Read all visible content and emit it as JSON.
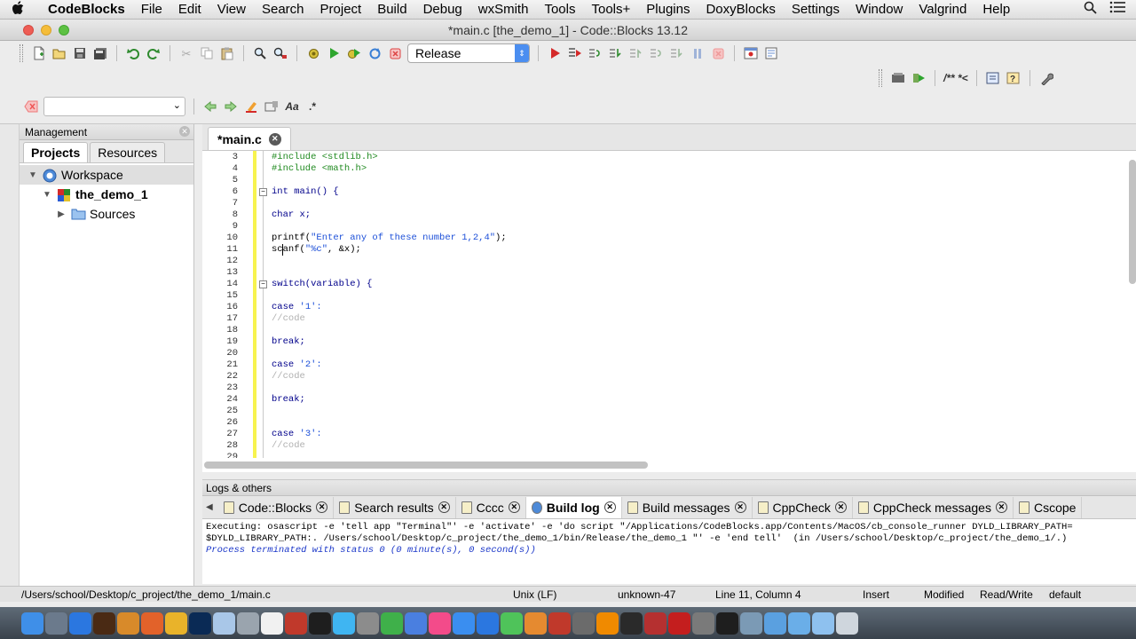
{
  "menubar": {
    "apple": "",
    "app_name": "CodeBlocks",
    "items": [
      "File",
      "Edit",
      "View",
      "Search",
      "Project",
      "Build",
      "Debug",
      "wxSmith",
      "Tools",
      "Tools+",
      "Plugins",
      "DoxyBlocks",
      "Settings",
      "Window",
      "Valgrind",
      "Help"
    ],
    "right_icons": [
      "search-icon",
      "list-icon"
    ]
  },
  "window": {
    "title": "*main.c [the_demo_1] - Code::Blocks 13.12",
    "traffic_lights": [
      "#ee5d55",
      "#f5bd3a",
      "#5dc143"
    ]
  },
  "toolbar": {
    "build_target": "Release",
    "search_text": "",
    "misc_label_doxy": "/** *<"
  },
  "management": {
    "title": "Management",
    "tabs": [
      "Projects",
      "Resources"
    ],
    "tree": {
      "workspace": "Workspace",
      "project": "the_demo_1",
      "folder": "Sources"
    }
  },
  "editor": {
    "tab_label": "*main.c",
    "lines": [
      {
        "n": "3",
        "text": "#include <stdlib.h>",
        "cls": "pp"
      },
      {
        "n": "4",
        "text": "#include <math.h>",
        "cls": "pp"
      },
      {
        "n": "5",
        "text": "",
        "cls": ""
      },
      {
        "n": "6",
        "text": "int main() {",
        "cls": "kw",
        "fold": true
      },
      {
        "n": "7",
        "text": "",
        "cls": ""
      },
      {
        "n": "8",
        "text": "char x;",
        "cls": "kw"
      },
      {
        "n": "9",
        "text": "",
        "cls": ""
      },
      {
        "n": "10",
        "text": "printf(\"Enter any of these number 1,2,4\");",
        "cls": "mix1"
      },
      {
        "n": "11",
        "text": "scanf(\"%c\", &x);",
        "cls": "mix2"
      },
      {
        "n": "12",
        "text": "",
        "cls": ""
      },
      {
        "n": "13",
        "text": "",
        "cls": ""
      },
      {
        "n": "14",
        "text": "switch(variable) {",
        "cls": "kw",
        "fold": true
      },
      {
        "n": "15",
        "text": "",
        "cls": ""
      },
      {
        "n": "16",
        "text": "case '1':",
        "cls": "case"
      },
      {
        "n": "17",
        "text": "//code",
        "cls": "cm"
      },
      {
        "n": "18",
        "text": "",
        "cls": ""
      },
      {
        "n": "19",
        "text": "break;",
        "cls": "kw"
      },
      {
        "n": "20",
        "text": "",
        "cls": ""
      },
      {
        "n": "21",
        "text": "case '2':",
        "cls": "case"
      },
      {
        "n": "22",
        "text": "//code",
        "cls": "cm"
      },
      {
        "n": "23",
        "text": "",
        "cls": ""
      },
      {
        "n": "24",
        "text": "break;",
        "cls": "kw"
      },
      {
        "n": "25",
        "text": "",
        "cls": ""
      },
      {
        "n": "26",
        "text": "",
        "cls": ""
      },
      {
        "n": "27",
        "text": "case '3':",
        "cls": "case"
      },
      {
        "n": "28",
        "text": "//code",
        "cls": "cm"
      },
      {
        "n": "29",
        "text": "",
        "cls": ""
      }
    ]
  },
  "logs": {
    "title": "Logs & others",
    "tabs": [
      {
        "label": "Code::Blocks",
        "active": false
      },
      {
        "label": "Search results",
        "active": false
      },
      {
        "label": "Cccc",
        "active": false
      },
      {
        "label": "Build log",
        "active": true
      },
      {
        "label": "Build messages",
        "active": false
      },
      {
        "label": "CppCheck",
        "active": false
      },
      {
        "label": "CppCheck messages",
        "active": false
      },
      {
        "label": "Cscope",
        "active": false
      }
    ],
    "lines": [
      "Executing: osascript -e 'tell app \"Terminal\"' -e 'activate' -e 'do script \"/Applications/CodeBlocks.app/Contents/MacOS/cb_console_runner DYLD_LIBRARY_PATH=",
      "$DYLD_LIBRARY_PATH:. /Users/school/Desktop/c_project/the_demo_1/bin/Release/the_demo_1 \"' -e 'end tell'  (in /Users/school/Desktop/c_project/the_demo_1/.)"
    ],
    "status_line": "Process terminated with status 0 (0 minute(s), 0 second(s))"
  },
  "statusbar": {
    "path": "/Users/school/Desktop/c_project/the_demo_1/main.c",
    "eol": "Unix (LF)",
    "encoding": "unknown-47",
    "position": "Line 11, Column 4",
    "mode": "Insert",
    "modified": "Modified",
    "rw": "Read/Write",
    "profile": "default"
  },
  "dock": {
    "apps": [
      "finder",
      "launchpad",
      "safari",
      "illustrator",
      "sublime",
      "firefox",
      "chrome",
      "photoshop",
      "preview",
      "help",
      "calendar",
      "photo-booth",
      "terminal",
      "messages",
      "system-preferences",
      "numbers",
      "keynote",
      "itunes",
      "app-store",
      "safari-2",
      "facetime",
      "books",
      "wps",
      "codeblocks",
      "vlc",
      "terminal-2",
      "filezilla",
      "acrobat",
      "vmware",
      "kindle",
      "ftp",
      "downloads",
      "documents",
      "folder",
      "trash"
    ]
  }
}
